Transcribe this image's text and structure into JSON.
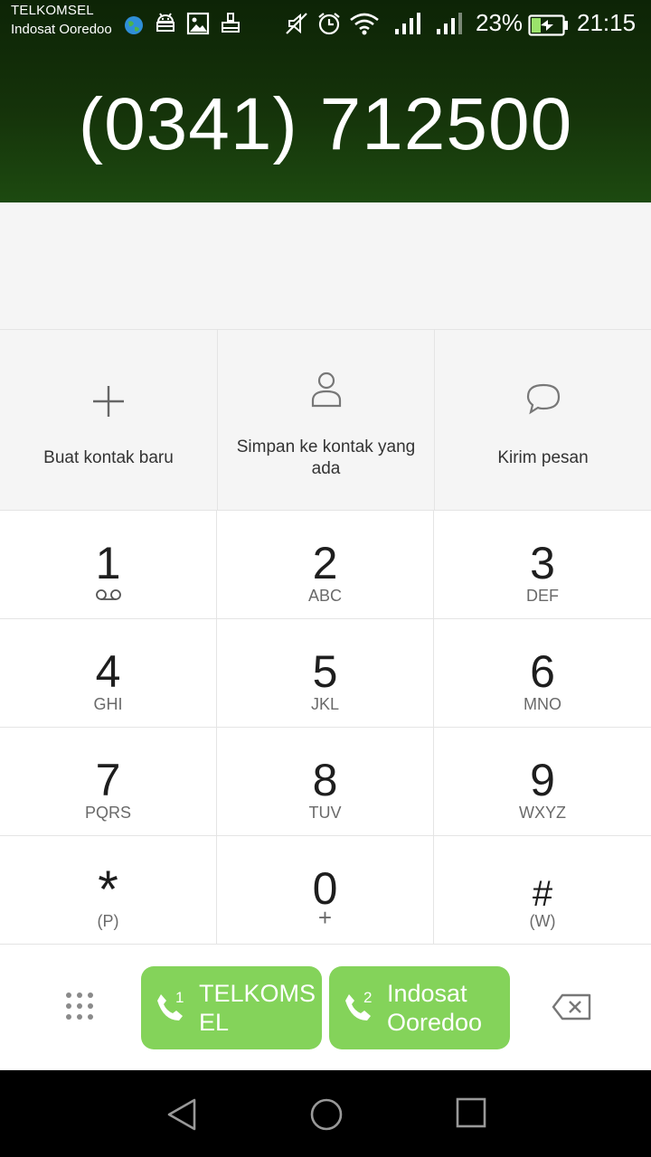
{
  "status_bar": {
    "carrier_1": "TELKOMSEL",
    "carrier_2": "Indosat Ooredoo",
    "battery_percent": "23%",
    "time": "21:15",
    "icons": [
      "globe-icon",
      "android-icon",
      "image-icon",
      "cleaner-icon",
      "mute-icon",
      "alarm-icon",
      "wifi-icon",
      "signal-icon",
      "signal-icon",
      "battery-charging-icon"
    ]
  },
  "dialed_number": "(0341) 712500",
  "actions": [
    {
      "label": "Buat kontak baru",
      "icon": "plus-icon"
    },
    {
      "label": "Simpan ke kontak yang ada",
      "icon": "person-icon"
    },
    {
      "label": "Kirim pesan",
      "icon": "chat-bubble-icon"
    }
  ],
  "keypad": [
    {
      "digit": "1",
      "letters": ""
    },
    {
      "digit": "2",
      "letters": "ABC"
    },
    {
      "digit": "3",
      "letters": "DEF"
    },
    {
      "digit": "4",
      "letters": "GHI"
    },
    {
      "digit": "5",
      "letters": "JKL"
    },
    {
      "digit": "6",
      "letters": "MNO"
    },
    {
      "digit": "7",
      "letters": "PQRS"
    },
    {
      "digit": "8",
      "letters": "TUV"
    },
    {
      "digit": "9",
      "letters": "WXYZ"
    },
    {
      "digit": "*",
      "letters": "(P)"
    },
    {
      "digit": "0",
      "letters": "+"
    },
    {
      "digit": "#",
      "letters": "(W)"
    }
  ],
  "call_buttons": [
    {
      "sim": "1",
      "name": "TELKOMS EL"
    },
    {
      "sim": "2",
      "name": "Indosat Ooredoo"
    }
  ],
  "colors": {
    "call_green": "#84d35a",
    "header_green": "#15330a"
  }
}
